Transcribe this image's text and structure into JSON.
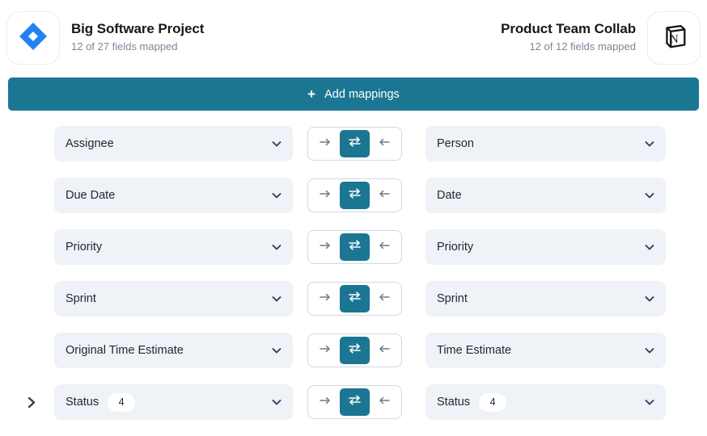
{
  "header": {
    "source": {
      "logo_icon": "jira-logo-icon",
      "title": "Big Software Project",
      "subtitle": "12 of 27 fields mapped"
    },
    "target": {
      "logo_icon": "notion-logo-icon",
      "title": "Product Team Collab",
      "subtitle": "12 of 12 fields mapped"
    }
  },
  "toolbar": {
    "add_mappings_label": "Add mappings",
    "add_mappings_icon": "plus-icon",
    "accent_color": "#1b7693"
  },
  "colors": {
    "accent": "#1b7693",
    "field_background": "#eff2f6",
    "field_text": "#1f2633",
    "subtitle_text": "#7d8899",
    "icon_navy": "#27405f",
    "jira_blue": "#2381f2"
  },
  "direction_options": [
    {
      "value": "to-target",
      "icon": "arrow-right-icon",
      "label": "→"
    },
    {
      "value": "bidirectional",
      "icon": "swap-horizontal-icon",
      "label": "⇄"
    },
    {
      "value": "to-source",
      "icon": "arrow-left-icon",
      "label": "←"
    }
  ],
  "mappings": [
    {
      "expandable": false,
      "source_field": "Assignee",
      "source_badge": null,
      "direction": "bidirectional",
      "target_field": "Person",
      "target_badge": null
    },
    {
      "expandable": false,
      "source_field": "Due Date",
      "source_badge": null,
      "direction": "bidirectional",
      "target_field": "Date",
      "target_badge": null
    },
    {
      "expandable": false,
      "source_field": "Priority",
      "source_badge": null,
      "direction": "bidirectional",
      "target_field": "Priority",
      "target_badge": null
    },
    {
      "expandable": false,
      "source_field": "Sprint",
      "source_badge": null,
      "direction": "bidirectional",
      "target_field": "Sprint",
      "target_badge": null
    },
    {
      "expandable": false,
      "source_field": "Original Time Estimate",
      "source_badge": null,
      "direction": "bidirectional",
      "target_field": "Time Estimate",
      "target_badge": null
    },
    {
      "expandable": true,
      "expand_icon": "chevron-right-icon",
      "source_field": "Status",
      "source_badge": "4",
      "direction": "bidirectional",
      "target_field": "Status",
      "target_badge": "4"
    }
  ]
}
